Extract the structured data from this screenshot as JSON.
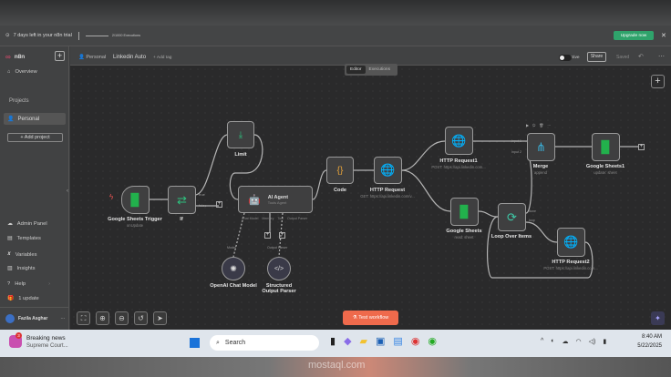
{
  "trial": {
    "text": "7 days left in your n8n trial",
    "executions": "2/1000 Executions",
    "upgrade": "Upgrade now"
  },
  "sidebar": {
    "brand": "n8n",
    "overview": "Overview",
    "projects": "Projects",
    "personal": "Personal",
    "add_project": "+ Add project",
    "items": [
      "Admin Panel",
      "Templates",
      "Variables",
      "Insights",
      "Help",
      "1 update"
    ],
    "user": "Fazila Asghar"
  },
  "header": {
    "project": "Personal",
    "workflow": "Linkedin Auto",
    "add_tag": "+ Add tag",
    "tabs": [
      "Editor",
      "Executions"
    ],
    "status": "Inactive",
    "share": "Share",
    "saved": "Saved"
  },
  "nodes": {
    "trigger": {
      "label": "Google Sheets Trigger",
      "sub": "onUpdate"
    },
    "if": {
      "label": "If",
      "true": "true",
      "false": "false"
    },
    "limit": {
      "label": "Limit"
    },
    "agent": {
      "label": "AI Agent",
      "sub": "Tools Agent",
      "ports": [
        "Chat Model",
        "Memory",
        "Tool",
        "Output Parser"
      ]
    },
    "openai": {
      "label": "OpenAI Chat Model",
      "port": "Model"
    },
    "parser": {
      "label": "Structured Output Parser",
      "port": "Output Parser"
    },
    "code": {
      "label": "Code"
    },
    "http": {
      "label": "HTTP Request",
      "sub": "GET: https://api.linkedin.com/v..."
    },
    "http1": {
      "label": "HTTP Request1",
      "sub": "POST: https://api.linkedin.com..."
    },
    "sheets": {
      "label": "Google Sheets",
      "sub": "read: sheet"
    },
    "loop": {
      "label": "Loop Over Items",
      "done": "done",
      "loop": "loop"
    },
    "merge": {
      "label": "Merge",
      "sub": "append",
      "in1": "Input 1",
      "in2": "Input 2"
    },
    "sheets1": {
      "label": "Google Sheets1",
      "sub": "update: sheet"
    },
    "http2": {
      "label": "HTTP Request2",
      "sub": "POST: https://api.linkedin.com..."
    }
  },
  "canvas": {
    "test": "Test workflow"
  },
  "taskbar": {
    "news_title": "Breaking news",
    "news_sub": "Supreme Court...",
    "badge": "3",
    "search": "Search",
    "time": "8:40 AM",
    "date": "5/22/2025"
  },
  "watermark": "mostaql.com"
}
